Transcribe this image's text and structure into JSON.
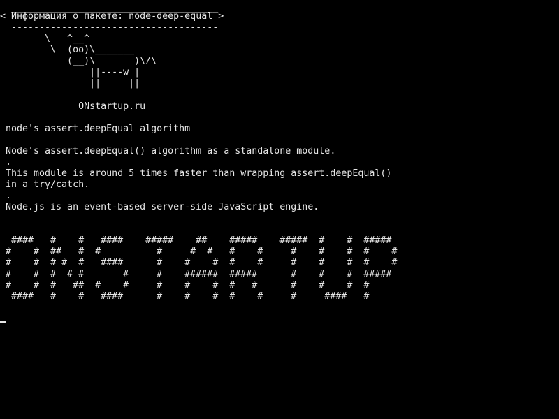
{
  "bubble": {
    "top_border": " _____________________________________",
    "message": "< Информация о пакете: node-deep-equal >",
    "bottom_border": " -------------------------------------"
  },
  "cow": [
    "       \\   ^__^",
    "        \\  (oo)\\_______",
    "           (__)\\       )\\/\\",
    "               ||----w |",
    "               ||     ||"
  ],
  "site": "             ONstartup.ru",
  "package_title": "node's assert.deepEqual algorithm",
  "description": {
    "line1": "Node's assert.deepEqual() algorithm as a standalone module.",
    "dot1": ".",
    "line2": "This module is around 5 times faster than wrapping assert.deepEqual()",
    "line3": "in a try/catch.",
    "dot2": ".",
    "line4": "Node.js is an event-based server-side JavaScript engine."
  },
  "banner": [
    " ####   #    #   ####    #####    ##    #####    #####  #    #  #####",
    "#    #  ##   #  #          #     #  #   #    #     #    #    #  #    #",
    "#    #  # #  #   ####      #    #    #  #    #     #    #    #  #    #",
    "#    #  #  # #       #     #    ######  #####      #    #    #  #####",
    "#    #  #   ##  #    #     #    #    #  #   #      #    #    #  #",
    " ####   #    #   ####      #    #    #  #    #     #     ####   #"
  ]
}
